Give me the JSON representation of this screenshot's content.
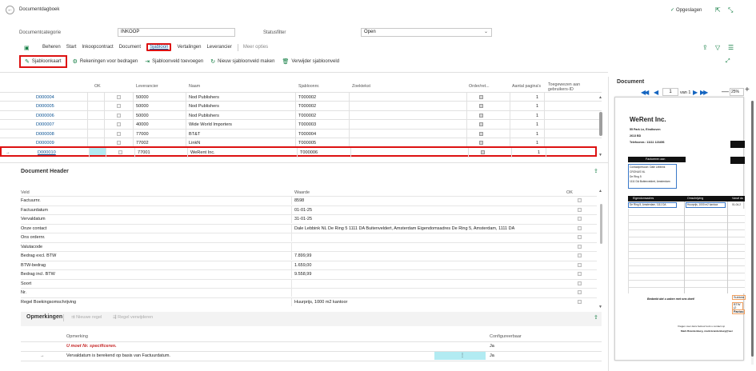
{
  "page": {
    "title": "Documentdagboek",
    "saved": "Opgeslagen"
  },
  "filters": {
    "category_label": "Documentcategorie",
    "category_value": "INKOOP",
    "status_label": "Statusfilter",
    "status_value": "Open"
  },
  "menu": {
    "items": [
      "Beheren",
      "Start",
      "Inkoopcontract",
      "Document",
      "Sjabloon",
      "Vertalingen",
      "Leverancier"
    ],
    "more": "Meer opties"
  },
  "toolbar": {
    "items": [
      "Sjabloonkaart",
      "Rekeningen voor bedragen",
      "Sjabloonveld toevoegen",
      "Nieuw sjabloonveld maken",
      "Verwijder sjabloonveld"
    ]
  },
  "grid": {
    "columns": [
      "OK",
      "Leverancier",
      "Naam",
      "Sjabloonnr.",
      "Zoektekst",
      "Order/ret...",
      "Aantal pagina's",
      "Toegewezen aan gebruikers-ID"
    ],
    "rows": [
      {
        "doc": "D000004",
        "vendor": "50000",
        "name": "Nod Publishers",
        "tmpl": "T000002",
        "pages": "1"
      },
      {
        "doc": "D000005",
        "vendor": "50000",
        "name": "Nod Publishers",
        "tmpl": "T000002",
        "pages": "1"
      },
      {
        "doc": "D000006",
        "vendor": "50000",
        "name": "Nod Publishers",
        "tmpl": "T000002",
        "pages": "1"
      },
      {
        "doc": "D000007",
        "vendor": "40000",
        "name": "Wide World Importers",
        "tmpl": "T000003",
        "pages": "1"
      },
      {
        "doc": "D000008",
        "vendor": "77000",
        "name": "BT&T",
        "tmpl": "T000004",
        "pages": "1"
      },
      {
        "doc": "D000009",
        "vendor": "77002",
        "name": "LinkN",
        "tmpl": "T000005",
        "pages": "1"
      },
      {
        "doc": "D000010",
        "vendor": "77001",
        "name": "WeRent Inc.",
        "tmpl": "T000006",
        "pages": "1"
      }
    ],
    "arrow": "→"
  },
  "header_section": {
    "title": "Document Header",
    "columns": {
      "field": "Veld",
      "value": "Waarde",
      "ok": "OK"
    },
    "rows": [
      {
        "field": "Factuurnr.",
        "value": "8598"
      },
      {
        "field": "Factuurdatum",
        "value": "01-01-25"
      },
      {
        "field": "Vervaldatum",
        "value": "31-01-25"
      },
      {
        "field": "Onze contact",
        "value": "Dale Lebbink NL De Ring 5 1111 DA Buitenveldert, Amsterdam Eigendomsadres De Ring 5, Amsterdam, 1111 DA"
      },
      {
        "field": "Ons ordernr.",
        "value": ""
      },
      {
        "field": "Valutacode",
        "value": ""
      },
      {
        "field": "Bedrag excl. BTW",
        "value": "7.899,99"
      },
      {
        "field": "BTW-bedrag",
        "value": "1.659,00"
      },
      {
        "field": "Bedrag incl. BTW",
        "value": "9.558,99"
      },
      {
        "field": "Soort",
        "value": ""
      },
      {
        "field": "Nr.",
        "value": ""
      },
      {
        "field": "Regel Boekingsomschrijving",
        "value": "Huurprijs, 1000 m2 kantoor"
      }
    ]
  },
  "remarks": {
    "title": "Opmerkingen",
    "actions": [
      "Nieuwe regel",
      "Regel verwijderen"
    ],
    "columns": {
      "remark": "Opmerking",
      "configurable": "Configureerbaar"
    },
    "rows": [
      {
        "text": "U moet Nr. specificeren.",
        "configurable": "Ja",
        "error": true
      },
      {
        "text": "Vervaldatum is berekend op basis van Factuurdatum.",
        "configurable": "Ja",
        "error": false
      }
    ]
  },
  "document_pane": {
    "title": "Document",
    "page_input": "1",
    "page_of": "van 1",
    "zoom": "25%",
    "invoice": {
      "company": "WeRent Inc.",
      "address1": "55 Park Ln, Eindhoven",
      "address2": "2613 BD",
      "phone": "Telefoonnr.: 11111 123456",
      "bill_to": "Factureren aan",
      "contact": "Contactpersoon: Dale Lebbink",
      "company2": "CRONUS NL",
      "street": "De Ring 5",
      "city": "1111 DA Buitenveldert, Amsterdam",
      "col1": "Eigendomsadres",
      "col2": "Omschrijving",
      "col3": "Vanaf da",
      "line1": "De Ring 5, Amsterdam, 1111 DA",
      "line2": "Huurprijs, 1000 m2 kantoor",
      "line3": "01-04-2",
      "subtotal": "Subtota",
      "btw": "BTW (2",
      "factuur": "Factuu",
      "thanks": "Bedankt dat u zaken met ons doet!",
      "footer1": "Vragen over deze factuur kunt u contact op",
      "footer2": "Mark Brandenburg, mark.brandenburg@wer"
    }
  }
}
